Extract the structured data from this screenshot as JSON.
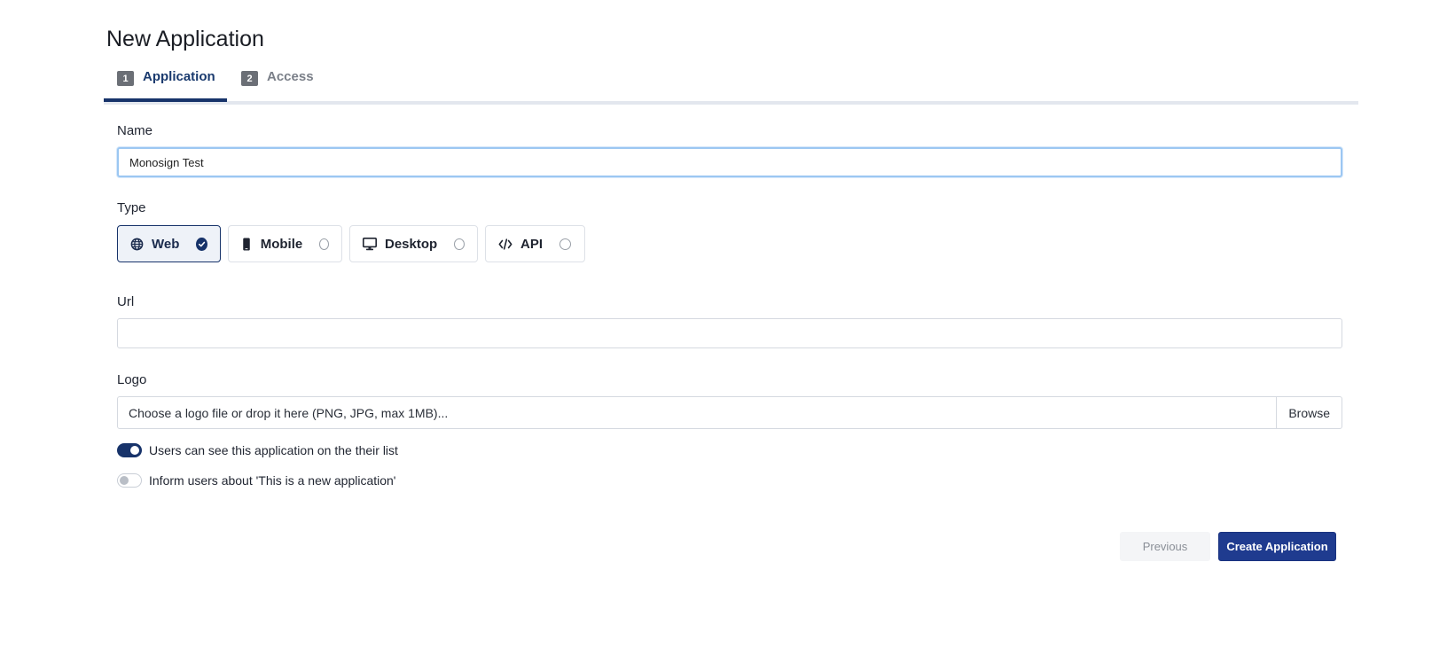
{
  "page": {
    "title": "New Application"
  },
  "tabs": [
    {
      "number": "1",
      "label": "Application",
      "active": true
    },
    {
      "number": "2",
      "label": "Access",
      "active": false
    }
  ],
  "form": {
    "name": {
      "label": "Name",
      "value": "Monosign Test"
    },
    "type": {
      "label": "Type",
      "selected": "Web",
      "options": [
        {
          "label": "Web",
          "icon": "globe-icon"
        },
        {
          "label": "Mobile",
          "icon": "mobile-icon"
        },
        {
          "label": "Desktop",
          "icon": "desktop-icon"
        },
        {
          "label": "API",
          "icon": "code-icon"
        }
      ]
    },
    "url": {
      "label": "Url",
      "value": ""
    },
    "logo": {
      "label": "Logo",
      "placeholder": "Choose a logo file or drop it here (PNG, JPG, max 1MB)...",
      "browse_label": "Browse"
    },
    "toggles": [
      {
        "label": "Users can see this application on the their list",
        "on": true
      },
      {
        "label": "Inform users about 'This is a new application'",
        "on": false
      }
    ]
  },
  "actions": {
    "previous_label": "Previous",
    "create_label": "Create Application"
  },
  "colors": {
    "accent": "#17336a",
    "primary_button": "#1f3b8f",
    "focus_ring": "#9cc7f2"
  }
}
